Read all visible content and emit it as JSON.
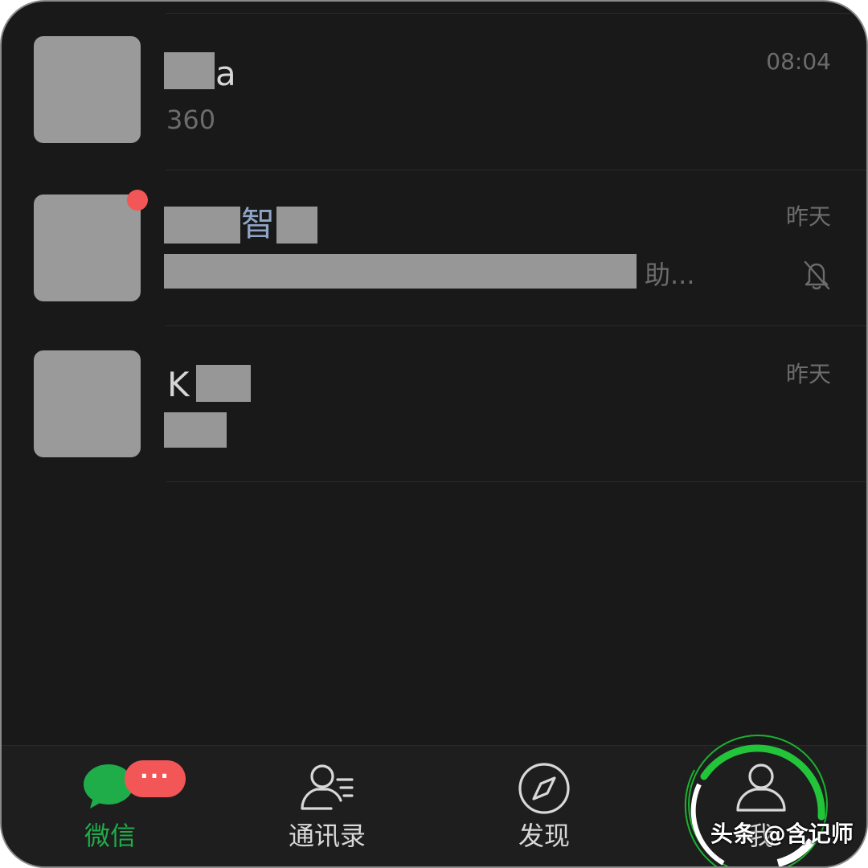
{
  "chats": [
    {
      "name_suffix": "a",
      "preview": "360",
      "time": "08:04",
      "muted": false,
      "unread_dot": false
    },
    {
      "name_middle": "智",
      "preview_suffix": "助...",
      "time": "昨天",
      "muted": true,
      "unread_dot": true
    },
    {
      "name_prefix": "K",
      "preview": "",
      "time": "昨天",
      "muted": false,
      "unread_dot": false
    }
  ],
  "tabbar": {
    "tabs": [
      {
        "label": "微信",
        "icon": "chat-bubble-icon",
        "active": true
      },
      {
        "label": "通讯录",
        "icon": "contacts-icon",
        "active": false
      },
      {
        "label": "发现",
        "icon": "compass-icon",
        "active": false
      },
      {
        "label": "我",
        "icon": "person-icon",
        "active": false
      }
    ],
    "chat_badge": "···"
  },
  "watermark": "头条 @含记师",
  "colors": {
    "background": "#191919",
    "accent_green": "#1fad4a",
    "badge_red": "#f25656",
    "placeholder_gray": "#979797",
    "muted_text": "#6c6c6c"
  }
}
